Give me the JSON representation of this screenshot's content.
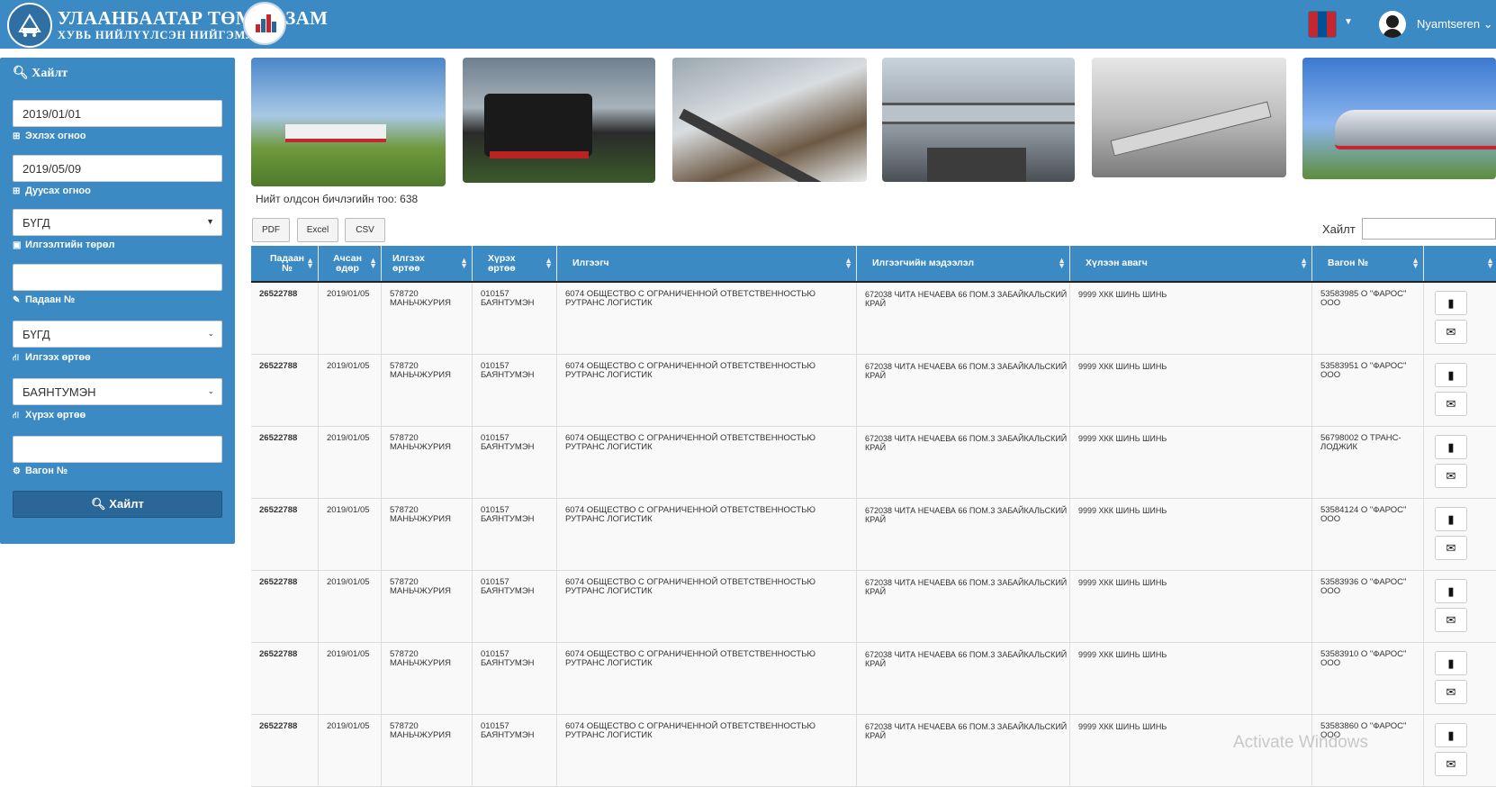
{
  "header": {
    "brand_title": "УЛААНБААТАР ТӨМӨР ЗАМ",
    "brand_subtitle": "ХУВЬ НИЙЛҮҮЛСЭН НИЙГЭМЛЭГ",
    "username": "Nyamtseren",
    "flag_icon": "mongolia-flag",
    "colors": {
      "bar": "#3b8ac4",
      "flag_red": "#c4272f",
      "flag_blue": "#015197",
      "flag_gold": "#f9cf02"
    }
  },
  "sidebar": {
    "title": "Хайлт",
    "start_date_value": "2019/01/01",
    "start_date_label": "Эхлэх огноо",
    "end_date_value": "2019/05/09",
    "end_date_label": "Дуусах огноо",
    "sender_type_value": "БҮГД",
    "sender_type_label": "Илгээлтийн төрөл",
    "shipment_no_value": "",
    "shipment_no_label": "Падаан №",
    "from_station_value": "БҮГД",
    "from_station_label": "Илгээх өртөө",
    "to_station_value": "БАЯНТУМЭН",
    "to_station_label": "Хүрэх өртөө",
    "wagon_value": "",
    "wagon_label": "Вагон №",
    "search_button": "Хайлт"
  },
  "results": {
    "count_text": "Нийт олдсон бичлэгийн тоо: 638",
    "export_buttons": [
      "PDF",
      "Excel",
      "CSV"
    ],
    "search_label": "Хайлт"
  },
  "table": {
    "columns": [
      "Падаан №",
      "Ачсан өдөр",
      "Илгээх өртөө",
      "Хүрэх өртөө",
      "Илгээгч",
      "Илгээгчийн мэдээлэл",
      "Хүлээн авагч",
      "Вагон №",
      ""
    ],
    "rows": [
      [
        "26522788",
        "2019/01/05",
        "578720 МАНЬЧЖУРИЯ",
        "010157 БАЯНТУМЭН",
        "6074 ОБЩЕСТВО С ОГРАНИЧЕННОЙ ОТВЕТСТВЕННОСТЬЮ РУТРАНС ЛОГИСТИК",
        "672038 ЧИТА НЕЧАЕВА 66 ПОМ.3 ЗАБАЙКАЛЬСКИЙ КРАЙ",
        "9999 ХКК ШИНЬ ШИНЬ",
        "53583985 О \"ФАРОС\" ООО"
      ],
      [
        "26522788",
        "2019/01/05",
        "578720 МАНЬЧЖУРИЯ",
        "010157 БАЯНТУМЭН",
        "6074 ОБЩЕСТВО С ОГРАНИЧЕННОЙ ОТВЕТСТВЕННОСТЬЮ РУТРАНС ЛОГИСТИК",
        "672038 ЧИТА НЕЧАЕВА 66 ПОМ.3 ЗАБАЙКАЛЬСКИЙ КРАЙ",
        "9999 ХКК ШИНЬ ШИНЬ",
        "53583951 О \"ФАРОС\" ООО"
      ],
      [
        "26522788",
        "2019/01/05",
        "578720 МАНЬЧЖУРИЯ",
        "010157 БАЯНТУМЭН",
        "6074 ОБЩЕСТВО С ОГРАНИЧЕННОЙ ОТВЕТСТВЕННОСТЬЮ РУТРАНС ЛОГИСТИК",
        "672038 ЧИТА НЕЧАЕВА 66 ПОМ.3 ЗАБАЙКАЛЬСКИЙ КРАЙ",
        "9999 ХКК ШИНЬ ШИНЬ",
        "56798002 О ТРАНС-ЛОДЖИК"
      ],
      [
        "26522788",
        "2019/01/05",
        "578720 МАНЬЧЖУРИЯ",
        "010157 БАЯНТУМЭН",
        "6074 ОБЩЕСТВО С ОГРАНИЧЕННОЙ ОТВЕТСТВЕННОСТЬЮ РУТРАНС ЛОГИСТИК",
        "672038 ЧИТА НЕЧАЕВА 66 ПОМ.3 ЗАБАЙКАЛЬСКИЙ КРАЙ",
        "9999 ХКК ШИНЬ ШИНЬ",
        "53584124 О \"ФАРОС\" ООО"
      ],
      [
        "26522788",
        "2019/01/05",
        "578720 МАНЬЧЖУРИЯ",
        "010157 БАЯНТУМЭН",
        "6074 ОБЩЕСТВО С ОГРАНИЧЕННОЙ ОТВЕТСТВЕННОСТЬЮ РУТРАНС ЛОГИСТИК",
        "672038 ЧИТА НЕЧАЕВА 66 ПОМ.3 ЗАБАЙКАЛЬСКИЙ КРАЙ",
        "9999 ХКК ШИНЬ ШИНЬ",
        "53583936 О \"ФАРОС\" ООО"
      ],
      [
        "26522788",
        "2019/01/05",
        "578720 МАНЬЧЖУРИЯ",
        "010157 БАЯНТУМЭН",
        "6074 ОБЩЕСТВО С ОГРАНИЧЕННОЙ ОТВЕТСТВЕННОСТЬЮ РУТРАНС ЛОГИСТИК",
        "672038 ЧИТА НЕЧАЕВА 66 ПОМ.3 ЗАБАЙКАЛЬСКИЙ КРАЙ",
        "9999 ХКК ШИНЬ ШИНЬ",
        "53583910 О \"ФАРОС\" ООО"
      ],
      [
        "26522788",
        "2019/01/05",
        "578720 МАНЬЧЖУРИЯ",
        "010157 БАЯНТУМЭН",
        "6074 ОБЩЕСТВО С ОГРАНИЧЕННОЙ ОТВЕТСТВЕННОСТЬЮ РУТРАНС ЛОГИСТИК",
        "672038 ЧИТА НЕЧАЕВА 66 ПОМ.3 ЗАБАЙКАЛЬСКИЙ КРАЙ",
        "9999 ХКК ШИНЬ ШИНЬ",
        "53583860 О \"ФАРОС\" ООО"
      ]
    ],
    "row_action_icons": [
      "document-icon",
      "envelope-icon"
    ]
  },
  "watermark": "Activate Windows"
}
